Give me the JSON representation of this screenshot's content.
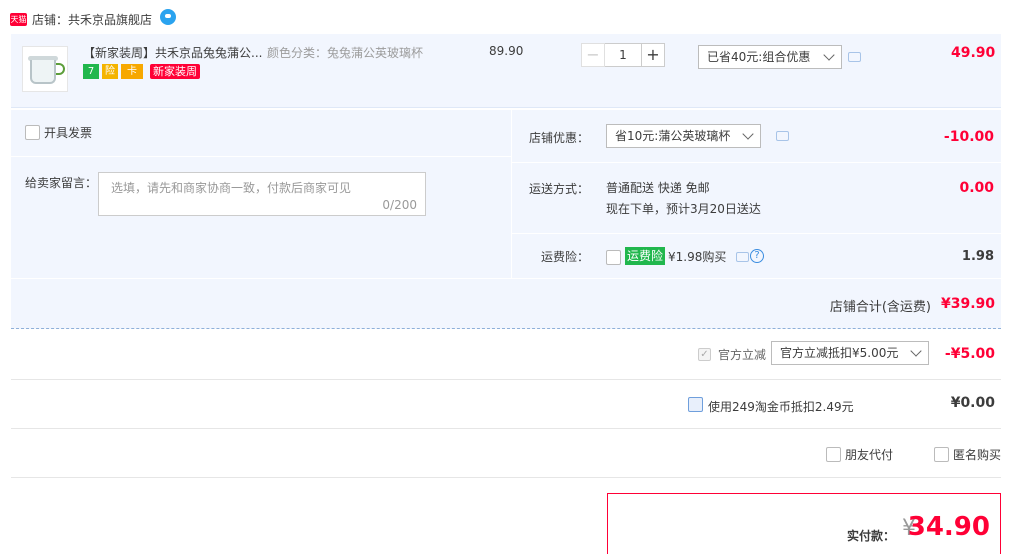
{
  "shop": {
    "badge": "天猫",
    "label": "店铺：共禾京品旗舰店"
  },
  "item": {
    "title": "【新家装周】共禾京品兔兔蒲公...",
    "sku": "颜色分类：兔兔蒲公英玻璃杯",
    "tags": [
      "7",
      "险",
      "卡"
    ],
    "promo_tag": "新家装周",
    "unit_price": "89.90",
    "quantity": {
      "minus": "−",
      "value": "1",
      "plus": "+"
    },
    "promo_select": "已省40元:组合优惠",
    "total": "49.90"
  },
  "options": {
    "invoice_label": "开具发票",
    "message_label": "给卖家留言：",
    "message_placeholder": "选填，请先和商家协商一致，付款后商家可见",
    "message_count": "0/200",
    "shop_promo_label": "店铺优惠：",
    "shop_promo_select": "省10元:蒲公英玻璃杯",
    "shop_promo_amount": "-10.00",
    "shipping_label": "运送方式：",
    "shipping_method": "普通配送 快递 免邮",
    "shipping_time": "现在下单，预计3月20日送达",
    "shipping_amount": "0.00",
    "insurance_label": "运费险：",
    "insurance_badge": "运费险",
    "insurance_text": "¥1.98购买",
    "insurance_help": "?",
    "insurance_amount": "1.98"
  },
  "shop_total": {
    "label": "店铺合计(含运费)",
    "amount": "¥39.90"
  },
  "official_discount": {
    "label": "官方立减",
    "select": "官方立减抵扣¥5.00元",
    "amount": "-¥5.00"
  },
  "coin": {
    "label": "使用249淘金币抵扣2.49元",
    "amount": "¥0.00"
  },
  "friend_pay_label": "朋友代付",
  "anonymous_label": "匿名购买",
  "pay": {
    "label": "实付款：",
    "currency": "¥",
    "amount": "34.90"
  },
  "colors": {
    "accent": "#ff0036",
    "panel": "#f2f6fe",
    "tmall": "#ff0036",
    "insurance_green": "#21b74d"
  }
}
